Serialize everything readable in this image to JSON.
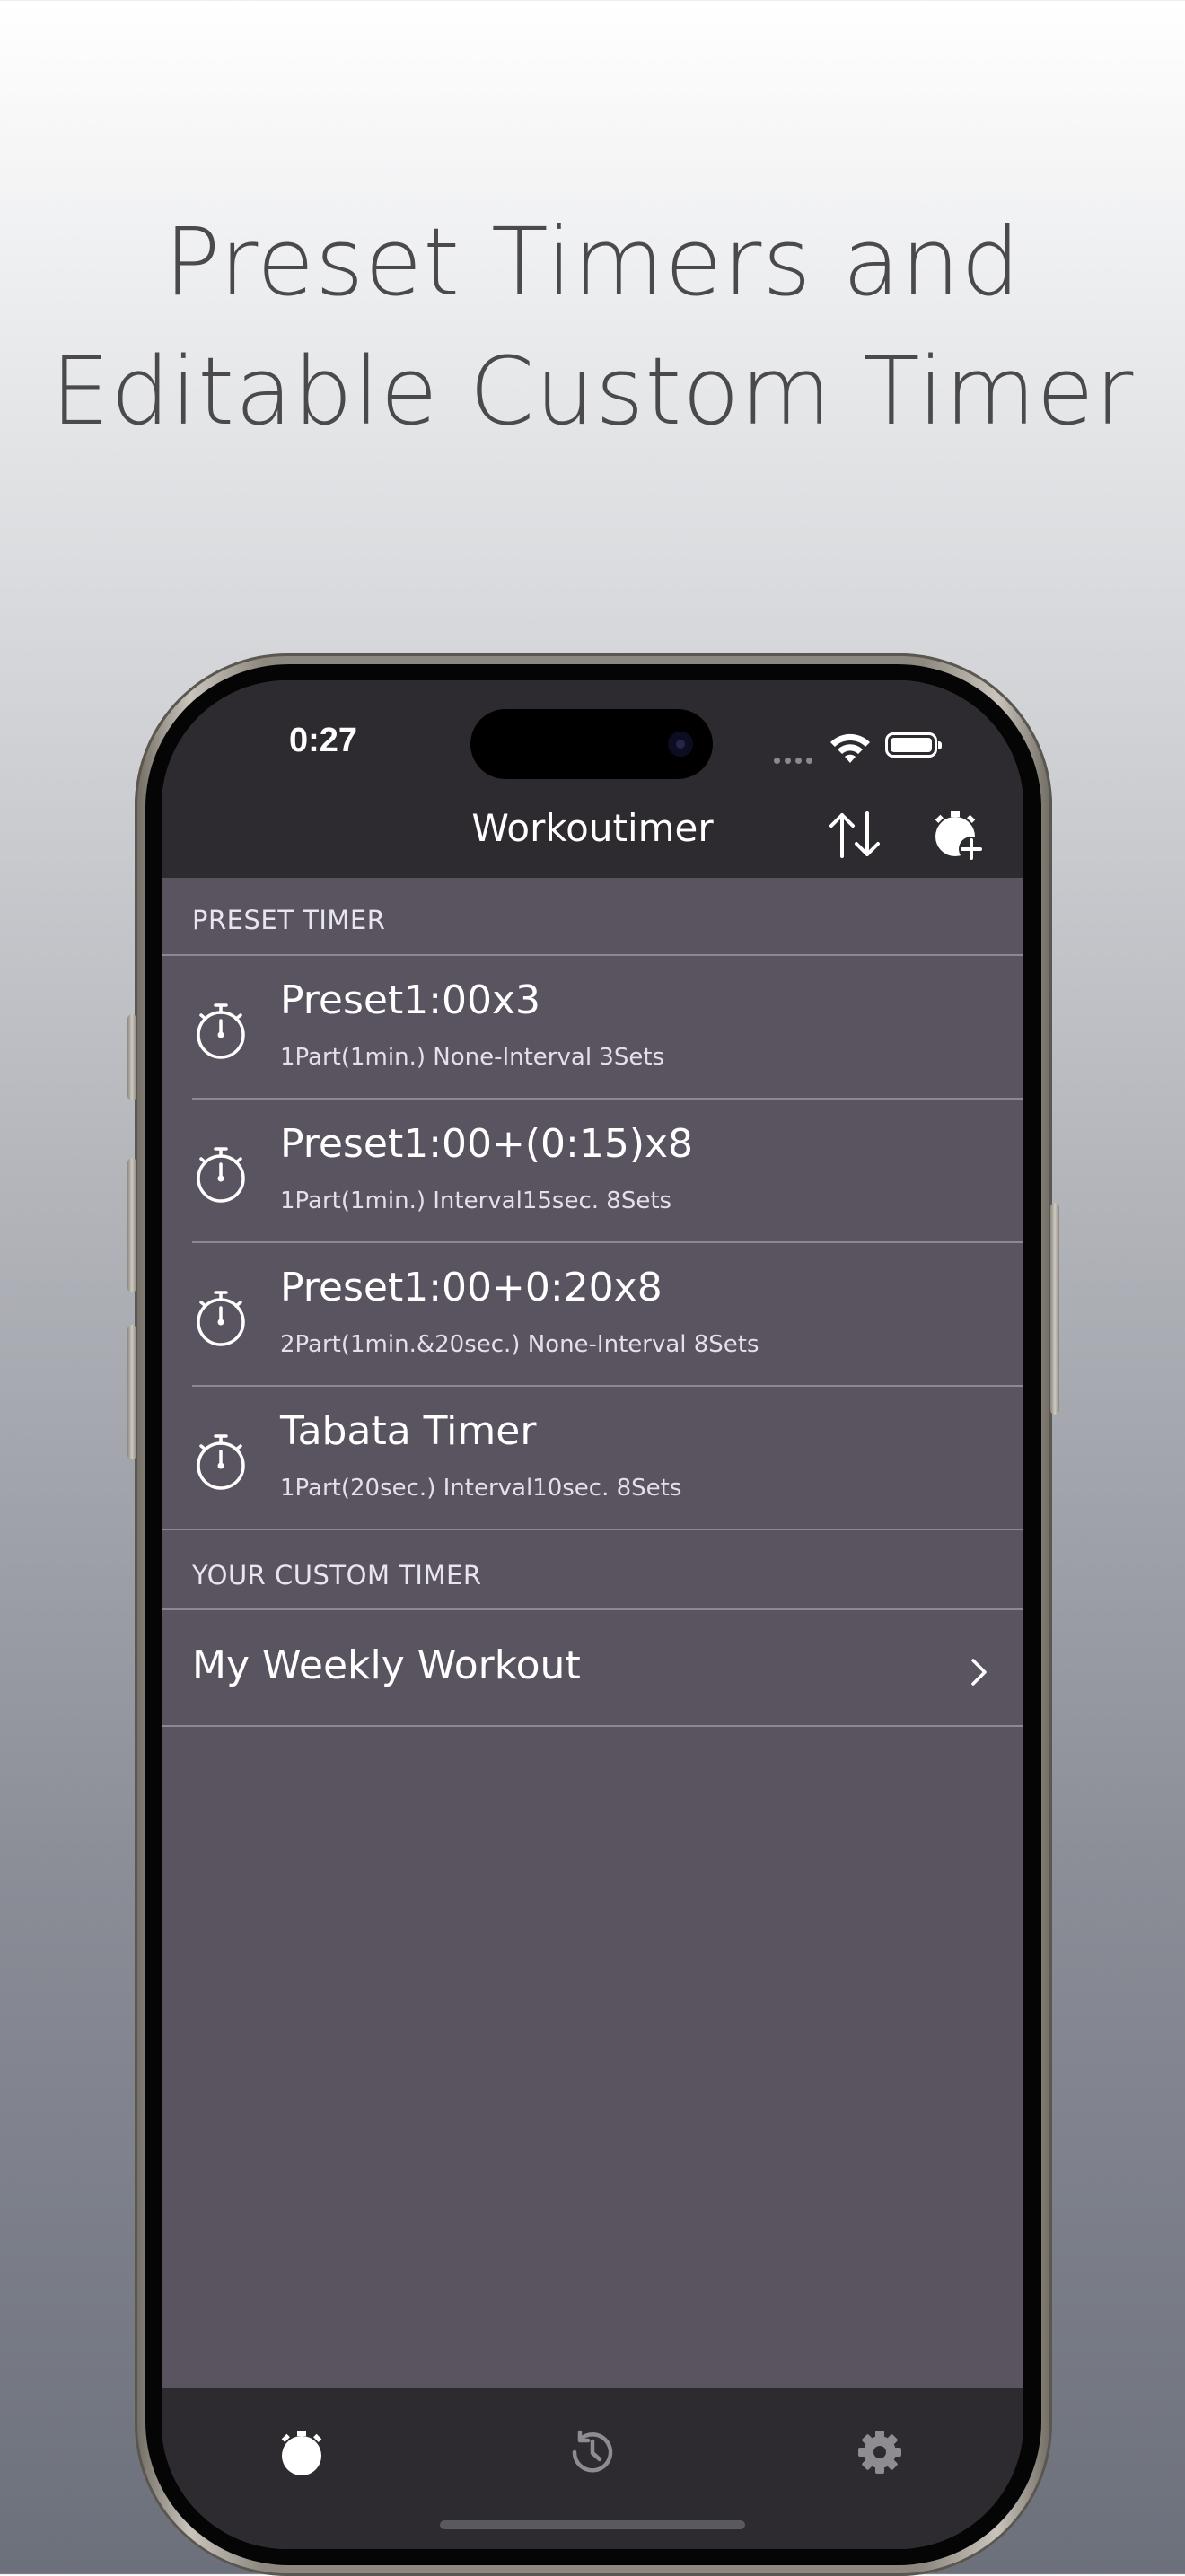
{
  "headline": {
    "line1": "Preset Timers and",
    "line2": "Editable Custom Timer"
  },
  "status_bar": {
    "time": "0:27",
    "wifi_icon": "wifi-icon",
    "battery_icon": "battery-icon"
  },
  "nav": {
    "title": "Workoutimer",
    "sort_icon": "sort-arrows-icon",
    "add_icon": "add-timer-icon"
  },
  "sections": {
    "preset_header": "PRESET TIMER",
    "custom_header": "YOUR CUSTOM TIMER"
  },
  "presets": [
    {
      "title": "Preset1:00x3",
      "subtitle": "1Part(1min.) None-Interval 3Sets",
      "icon": "stopwatch-icon"
    },
    {
      "title": "Preset1:00+(0:15)x8",
      "subtitle": "1Part(1min.) Interval15sec. 8Sets",
      "icon": "stopwatch-icon"
    },
    {
      "title": "Preset1:00+0:20x8",
      "subtitle": "2Part(1min.&20sec.) None-Interval 8Sets",
      "icon": "stopwatch-icon"
    },
    {
      "title": "Tabata Timer",
      "subtitle": "1Part(20sec.) Interval10sec. 8Sets",
      "icon": "stopwatch-icon"
    }
  ],
  "custom_timers": [
    {
      "title": "My Weekly Workout",
      "icon": "chevron-right-icon"
    }
  ],
  "tabbar": {
    "tabs": [
      {
        "icon": "stopwatch-icon",
        "selected": true
      },
      {
        "icon": "history-icon",
        "selected": false
      },
      {
        "icon": "gear-icon",
        "selected": false
      }
    ]
  },
  "colors": {
    "content_bg": "#5a5360",
    "bar_bg": "#2d2b2f",
    "separator": "#8d8793",
    "text_primary": "#ffffff",
    "tab_inactive": "#8e8c92"
  }
}
